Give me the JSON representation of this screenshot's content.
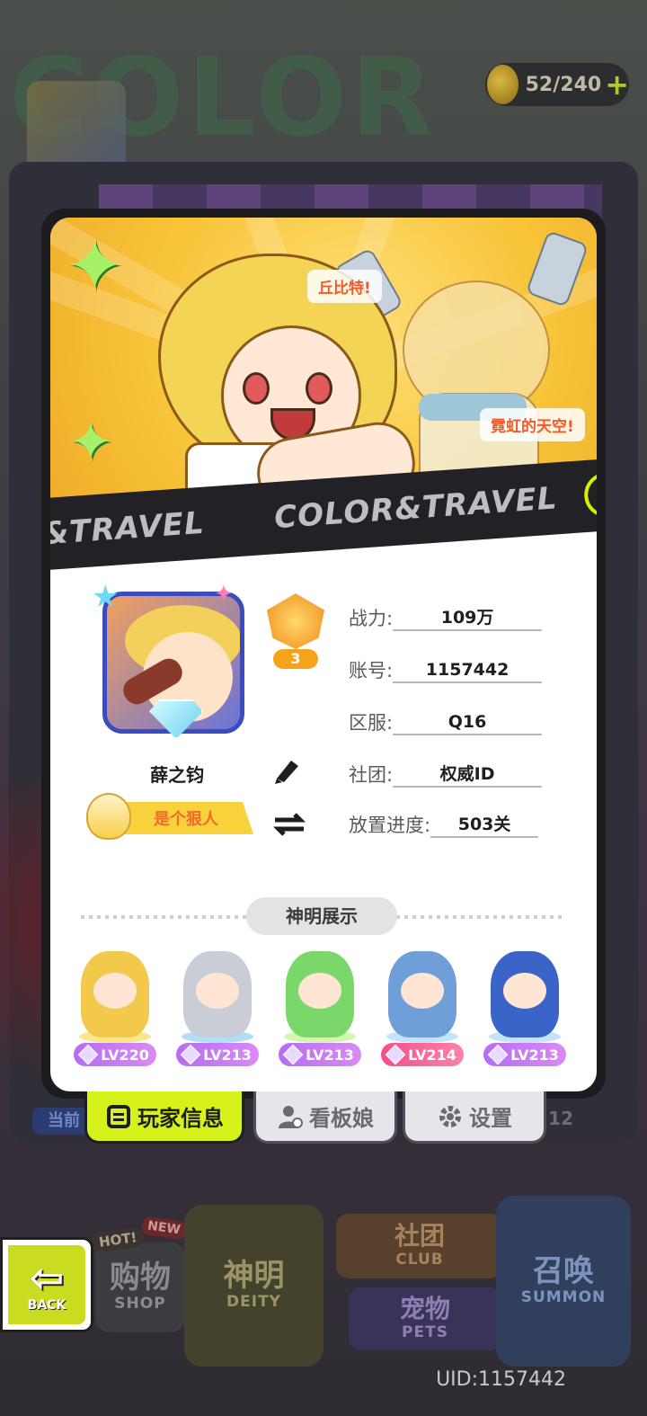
{
  "background": {
    "title_fragment": "COLOR",
    "coins": "52/240",
    "side_button": "当前",
    "side_number": "12",
    "uid_text": "UID:1157442"
  },
  "bottom_nav": {
    "hot_tag": "HOT!",
    "new_tag": "NEW",
    "shop": {
      "cn": "购物",
      "en": "SHOP"
    },
    "deity": {
      "cn": "神明",
      "en": "DEITY"
    },
    "club": {
      "cn": "社团",
      "en": "CLUB"
    },
    "pets": {
      "cn": "宠物",
      "en": "PETS"
    },
    "summon": {
      "cn": "召唤",
      "en": "SUMMON"
    },
    "back": "BACK"
  },
  "card": {
    "speech_1": "丘比特!",
    "speech_2": "霓虹的天空!",
    "ribbon_left": "&TRAVEL",
    "ribbon_main": "COLOR&TRAVEL",
    "ribbon_cut": "CO",
    "rank_level": "3",
    "player_name": "薛之钧",
    "title": "是个狠人",
    "info": [
      {
        "label": "战力:",
        "value": "109万"
      },
      {
        "label": "账号:",
        "value": "1157442"
      },
      {
        "label": "区服:",
        "value": "Q16"
      },
      {
        "label": "社团:",
        "value": "权威ID"
      },
      {
        "label": "放置进度:",
        "value": "503关"
      }
    ],
    "deity_section_label": "神明展示",
    "deities": [
      {
        "level": "LV220",
        "color": "#f2c94a"
      },
      {
        "level": "LV213",
        "color": "#c9ced6"
      },
      {
        "level": "LV213",
        "color": "#7ad86a"
      },
      {
        "level": "LV214",
        "color": "#6f9fd8"
      },
      {
        "level": "LV213",
        "color": "#3a64c8"
      }
    ]
  },
  "tabs": {
    "player_info": "玩家信息",
    "mascot": "看板娘",
    "settings": "设置"
  },
  "colors": {
    "accent_lime": "#d7f21a",
    "card_bg": "#ffffff",
    "banner_yellow": "#f8c53a"
  }
}
